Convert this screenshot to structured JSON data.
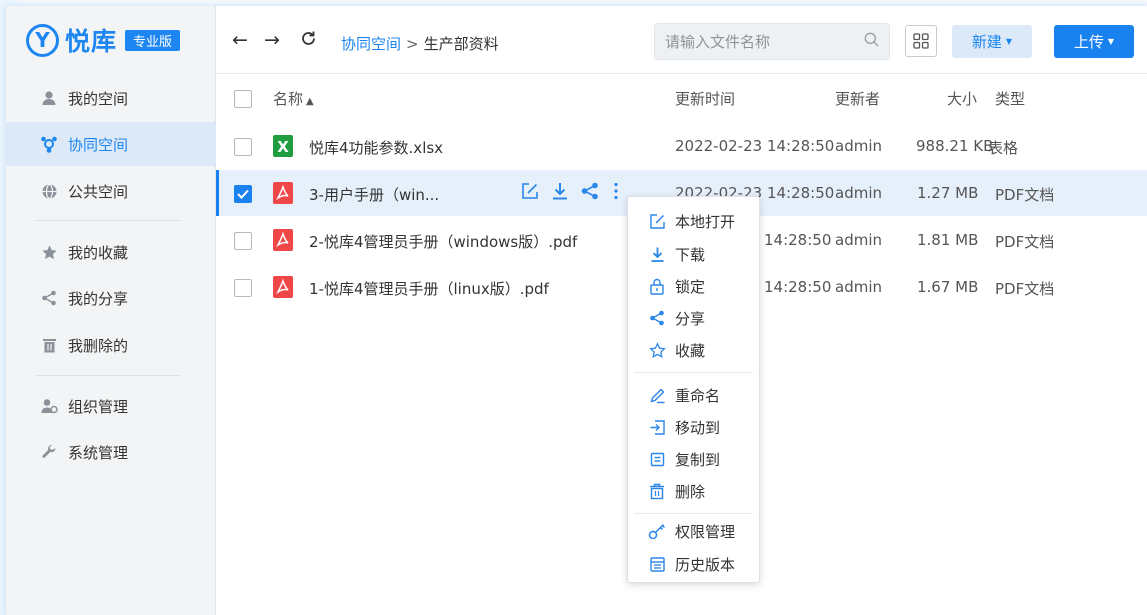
{
  "brand": {
    "logo_mark": "Y",
    "name": "悦库",
    "edition": "专业版",
    "color": "#1d86f0"
  },
  "sidebar": {
    "items": [
      {
        "label": "我的空间",
        "icon": "user-icon"
      },
      {
        "label": "协同空间",
        "icon": "collab-icon",
        "active": true
      },
      {
        "label": "公共空间",
        "icon": "globe-icon"
      },
      {
        "label": "我的收藏",
        "icon": "star-icon"
      },
      {
        "label": "我的分享",
        "icon": "share-icon"
      },
      {
        "label": "我删除的",
        "icon": "trash-icon"
      },
      {
        "label": "组织管理",
        "icon": "org-icon"
      },
      {
        "label": "系统管理",
        "icon": "wrench-icon"
      }
    ]
  },
  "toolbar": {
    "breadcrumb": {
      "root": "协同空间",
      "separator": ">",
      "current": "生产部资料"
    },
    "search_placeholder": "请输入文件名称",
    "new_label": "新建",
    "upload_label": "上传"
  },
  "table": {
    "columns": {
      "name": "名称",
      "sort_arrow": "▲",
      "updated": "更新时间",
      "updater": "更新者",
      "size": "大小",
      "type": "类型"
    },
    "rows": [
      {
        "name": "悦库4功能参数.xlsx",
        "icon": "excel-icon",
        "updated": "2022-02-23 14:28:50",
        "updater": "admin",
        "size": "988.21 KB",
        "type": "表格",
        "checked": false
      },
      {
        "name": "3-用户手册（win...",
        "icon": "pdf-icon",
        "updated": "2022-02-23 14:28:50",
        "updater": "admin",
        "size": "1.27 MB",
        "type": "PDF文档",
        "checked": true
      },
      {
        "name": "2-悦库4管理员手册（windows版）.pdf",
        "icon": "pdf-icon",
        "updated": "14:28:50",
        "updater": "admin",
        "size": "1.81 MB",
        "type": "PDF文档",
        "checked": false
      },
      {
        "name": "1-悦库4管理员手册（linux版）.pdf",
        "icon": "pdf-icon",
        "updated": "14:28:50",
        "updater": "admin",
        "size": "1.67 MB",
        "type": "PDF文档",
        "checked": false
      }
    ]
  },
  "context_menu": {
    "items": [
      {
        "label": "本地打开",
        "icon": "open-local-icon"
      },
      {
        "label": "下载",
        "icon": "download-icon"
      },
      {
        "label": "锁定",
        "icon": "lock-icon"
      },
      {
        "label": "分享",
        "icon": "share-icon"
      },
      {
        "label": "收藏",
        "icon": "star-outline-icon"
      },
      {
        "label": "重命名",
        "icon": "rename-icon"
      },
      {
        "label": "移动到",
        "icon": "move-icon"
      },
      {
        "label": "复制到",
        "icon": "copy-icon"
      },
      {
        "label": "删除",
        "icon": "delete-icon"
      },
      {
        "label": "权限管理",
        "icon": "key-icon"
      },
      {
        "label": "历史版本",
        "icon": "history-icon"
      }
    ]
  }
}
